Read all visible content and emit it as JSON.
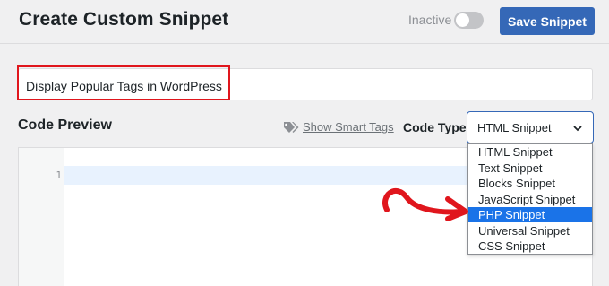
{
  "header": {
    "title": "Create Custom Snippet",
    "status_label": "Inactive",
    "toggle_state": "off",
    "save_label": "Save Snippet"
  },
  "snippet": {
    "title_value": "Display Popular Tags in WordPress"
  },
  "code_section": {
    "title": "Code Preview",
    "smart_tags_label": "Show Smart Tags",
    "code_type_label": "Code Type",
    "selected_type": "HTML Snippet",
    "line_numbers": [
      "1"
    ]
  },
  "dropdown": {
    "options": [
      "HTML Snippet",
      "Text Snippet",
      "Blocks Snippet",
      "JavaScript Snippet",
      "PHP Snippet",
      "Universal Snippet",
      "CSS Snippet"
    ],
    "highlighted": "PHP Snippet"
  },
  "colors": {
    "accent": "#3568b7",
    "highlight_border": "#e0161d",
    "selected_option": "#1a73e8",
    "arrow": "#e0161d"
  },
  "icons": {
    "tag": "tag-icon",
    "chevron": "chevron-down-icon",
    "annotation": "curved-arrow-icon"
  }
}
